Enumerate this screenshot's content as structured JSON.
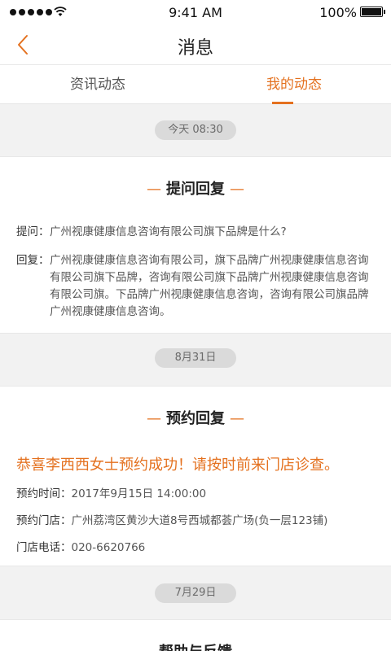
{
  "status_bar": {
    "time": "9:41 AM",
    "battery": "100%"
  },
  "nav": {
    "title": "消息",
    "back_icon": "chevron-left-icon"
  },
  "tabs": [
    {
      "label": "资讯动态",
      "active": false
    },
    {
      "label": "我的动态",
      "active": true
    }
  ],
  "colors": {
    "accent": "#e4711f"
  },
  "feed": [
    {
      "date": "今天 08:30",
      "title": "提问回复",
      "question_label": "提问：",
      "question": "广州视康健康信息咨询有限公司旗下品牌是什么?",
      "reply_label": "回复：",
      "reply": "广州视康健康信息咨询有限公司，旗下品牌广州视康健康信息咨询有限公司旗下品牌，咨询有限公司旗下品牌广州视康健康信息咨询有限公司旗。下品牌广州视康健康信息咨询，咨询有限公司旗品牌广州视康健康信息咨询。"
    },
    {
      "date": "8月31日",
      "title": "预约回复",
      "headline": "恭喜李西西女士预约成功！请按时前来门店诊查。",
      "time_label": "预约时间：",
      "time_value": "2017年9月15日 14:00:00",
      "store_label": "预约门店：",
      "store_value": "广州荔湾区黄沙大道8号西城都荟广场(负一层123铺)",
      "phone_label": "门店电话：",
      "phone_value": "020-6620766"
    },
    {
      "date": "7月29日",
      "title": "帮助与反馈"
    }
  ]
}
